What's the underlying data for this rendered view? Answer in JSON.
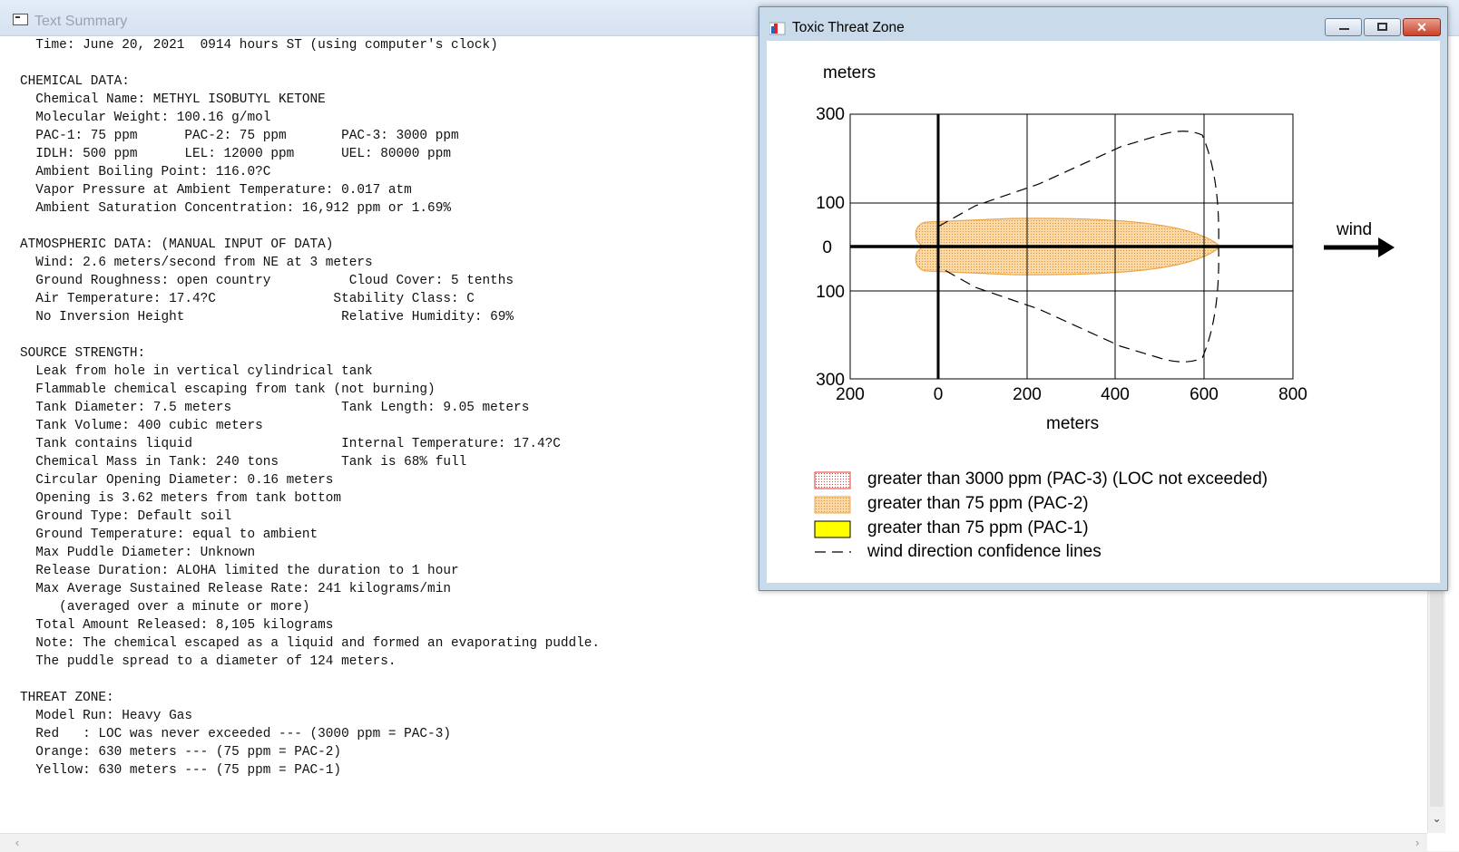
{
  "text_summary": {
    "title": "Text Summary",
    "lines": [
      "  Time: June 20, 2021  0914 hours ST (using computer's clock)",
      "",
      "CHEMICAL DATA:",
      "  Chemical Name: METHYL ISOBUTYL KETONE",
      "  Molecular Weight: 100.16 g/mol",
      "  PAC-1: 75 ppm      PAC-2: 75 ppm       PAC-3: 3000 ppm",
      "  IDLH: 500 ppm      LEL: 12000 ppm      UEL: 80000 ppm",
      "  Ambient Boiling Point: 116.0?C",
      "  Vapor Pressure at Ambient Temperature: 0.017 atm",
      "  Ambient Saturation Concentration: 16,912 ppm or 1.69%",
      "",
      "ATMOSPHERIC DATA: (MANUAL INPUT OF DATA)",
      "  Wind: 2.6 meters/second from NE at 3 meters",
      "  Ground Roughness: open country          Cloud Cover: 5 tenths",
      "  Air Temperature: 17.4?C               Stability Class: C",
      "  No Inversion Height                    Relative Humidity: 69%",
      "",
      "SOURCE STRENGTH:",
      "  Leak from hole in vertical cylindrical tank",
      "  Flammable chemical escaping from tank (not burning)",
      "  Tank Diameter: 7.5 meters              Tank Length: 9.05 meters",
      "  Tank Volume: 400 cubic meters",
      "  Tank contains liquid                   Internal Temperature: 17.4?C",
      "  Chemical Mass in Tank: 240 tons        Tank is 68% full",
      "  Circular Opening Diameter: 0.16 meters",
      "  Opening is 3.62 meters from tank bottom",
      "  Ground Type: Default soil",
      "  Ground Temperature: equal to ambient",
      "  Max Puddle Diameter: Unknown",
      "  Release Duration: ALOHA limited the duration to 1 hour",
      "  Max Average Sustained Release Rate: 241 kilograms/min",
      "     (averaged over a minute or more)",
      "  Total Amount Released: 8,105 kilograms",
      "  Note: The chemical escaped as a liquid and formed an evaporating puddle.",
      "  The puddle spread to a diameter of 124 meters.",
      "",
      "THREAT ZONE:",
      "  Model Run: Heavy Gas",
      "  Red   : LOC was never exceeded --- (3000 ppm = PAC-3)",
      "  Orange: 630 meters --- (75 ppm = PAC-2)",
      "  Yellow: 630 meters --- (75 ppm = PAC-1)"
    ]
  },
  "threat_zone_window": {
    "title": "Toxic Threat Zone",
    "y_unit": "meters",
    "x_unit": "meters",
    "wind_label": "wind",
    "x_ticks": [
      "200",
      "0",
      "200",
      "400",
      "600",
      "800"
    ],
    "y_ticks": [
      "300",
      "100",
      "0",
      "100",
      "300"
    ],
    "legend": [
      {
        "label": "greater than 3000 ppm (PAC-3) (LOC not exceeded)",
        "swatch": "red-dotted",
        "color": "#e53935"
      },
      {
        "label": "greater than 75 ppm (PAC-2)",
        "swatch": "orange-dotted",
        "color": "#f5a623"
      },
      {
        "label": "greater than 75 ppm (PAC-1)",
        "swatch": "yellow-solid",
        "color": "#ffff00"
      },
      {
        "label": "wind direction confidence lines",
        "swatch": "dashed-line",
        "color": "#000000"
      }
    ],
    "plume": {
      "orange_zone": {
        "downwind_start_m": -50,
        "downwind_end_m": 630,
        "half_width_m": 63
      },
      "confidence_lines": {
        "max_downwind_m": 630,
        "max_half_width_m": 255
      }
    }
  }
}
